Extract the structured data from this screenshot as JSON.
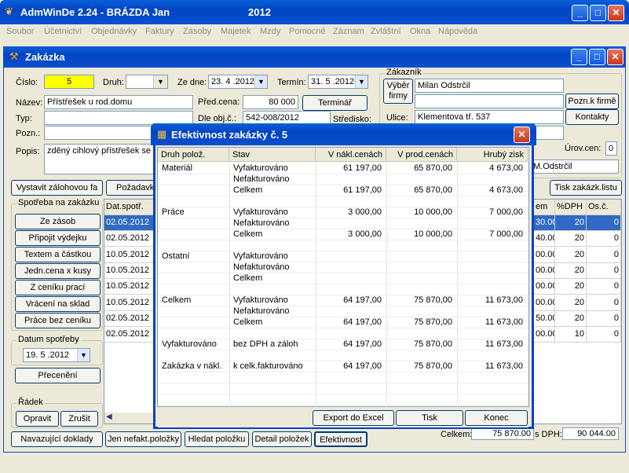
{
  "app": {
    "title": "AdmWinDe 2.24 - BRÁZDA Jan",
    "year": "2012"
  },
  "menu": [
    "Soubor",
    "Účetnictví",
    "Objednávky",
    "Faktury",
    "Zásoby",
    "Majetek",
    "Mzdy",
    "Pomocné",
    "Záznam",
    "Zvláštní",
    "Okna",
    "Nápověda"
  ],
  "child": {
    "title": "Zakázka"
  },
  "form": {
    "cislo_label": "Číslo:",
    "cislo": "5",
    "druh_label": "Druh:",
    "zedne_label": "Ze dne:",
    "zedne": "23. 4 .2012",
    "termin_label": "Termín:",
    "termin": "31. 5 .2012",
    "nazev_label": "Název:",
    "nazev": "Přístřešek u rod.domu",
    "predcena_label": "Před.cena:",
    "predcena": "80 000",
    "terminar_btn": "Terminář",
    "typ_label": "Typ:",
    "dleobj_label": "Dle obj.č.:",
    "dleobj": "542-008/2012",
    "stredisko_label": "Středisko:",
    "pozn_label": "Pozn.:",
    "popis_label": "Popis:",
    "popis": "zděný cihlový přístřešek se s"
  },
  "zakaznik": {
    "group_label": "Zákazník",
    "vyber_btn": "Výběr firmy",
    "name": "Milan Odstrčil",
    "pozn_firme_btn": "Pozn.k firmě",
    "kontakty_btn": "Kontakty",
    "ulice_label": "Ulice:",
    "ulice": "Klementova tř. 537",
    "urov_label": "Úrov.cen:",
    "urov": "0",
    "short_name": "M.Odstrčil"
  },
  "toolbar": {
    "zalohova": "Vystavit zálohovou fa",
    "pozadavek": "Požadavk",
    "tisk_listu": "Tisk zakázk.listu"
  },
  "spotreba": {
    "group_label": "Spotřeba na zakázku",
    "buttons": [
      "Ze zásob",
      "Připojit výdejku",
      "Textem a částkou",
      "Jedn.cena x kusy",
      "Z ceníku prací",
      "Vrácení na sklad",
      "Práce bez ceníku"
    ]
  },
  "datum": {
    "group_label": "Datum spotřeby",
    "value": "19. 5 .2012",
    "preceneni_btn": "Přecenění"
  },
  "radek": {
    "group_label": "Řádek",
    "opravit": "Opravit",
    "zrusit": "Zrušit"
  },
  "grid": {
    "head_left": "Dat.spotř.",
    "head_right": [
      "em",
      "%DPH",
      "Os.č."
    ],
    "dates": [
      "02.05.2012",
      "02.05.2012",
      "10.05.2012",
      "10.05.2012",
      "10.05.2012",
      "10.05.2012",
      "02.05.2012",
      "02.05.2012"
    ],
    "right_rows": [
      [
        "30.00",
        "20",
        "0"
      ],
      [
        "40.00",
        "20",
        "0"
      ],
      [
        "00.00",
        "20",
        "0"
      ],
      [
        "00.00",
        "20",
        "0"
      ],
      [
        "00.00",
        "20",
        "0"
      ],
      [
        "00.00",
        "20",
        "0"
      ],
      [
        "50.00",
        "20",
        "0"
      ],
      [
        "00.00",
        "10",
        "0"
      ]
    ]
  },
  "bottom": {
    "navazujici": "Navazující doklady",
    "jen_nefakt": "Jen nefakt.položky",
    "hledat": "Hledat položku",
    "detail": "Detail položek",
    "efektivnost": "Efektivnost",
    "celkem_label": "Celkem:",
    "celkem": "75 870.00",
    "sdph_label": "s DPH:",
    "sdph": "90 044.00"
  },
  "dialog": {
    "title": "Efektivnost zakázky č. 5",
    "headers": [
      "Druh polož.",
      "Stav",
      "V nákl.cenách",
      "V prod.cenách",
      "Hrubý zisk"
    ],
    "rows": [
      [
        "Materiál",
        "Vyfakturováno",
        "61 197,00",
        "65 870,00",
        "4 673,00"
      ],
      [
        "",
        "Nefakturováno",
        "",
        "",
        ""
      ],
      [
        "",
        "Celkem",
        "61 197,00",
        "65 870,00",
        "4 673,00"
      ],
      [
        "",
        "",
        "",
        "",
        ""
      ],
      [
        "Práce",
        "Vyfakturováno",
        "3 000,00",
        "10 000,00",
        "7 000,00"
      ],
      [
        "",
        "Nefakturováno",
        "",
        "",
        ""
      ],
      [
        "",
        "Celkem",
        "3 000,00",
        "10 000,00",
        "7 000,00"
      ],
      [
        "",
        "",
        "",
        "",
        ""
      ],
      [
        "Ostatní",
        "Vyfakturováno",
        "",
        "",
        ""
      ],
      [
        "",
        "Nefakturováno",
        "",
        "",
        ""
      ],
      [
        "",
        "Celkem",
        "",
        "",
        ""
      ],
      [
        "",
        "",
        "",
        "",
        ""
      ],
      [
        "Celkem",
        "Vyfakturováno",
        "64 197,00",
        "75 870,00",
        "11 673,00"
      ],
      [
        "",
        "Nefakturováno",
        "",
        "",
        ""
      ],
      [
        "",
        "Celkem",
        "64 197,00",
        "75 870,00",
        "11 673,00"
      ],
      [
        "",
        "",
        "",
        "",
        ""
      ],
      [
        "Vyfakturováno",
        "bez DPH a záloh",
        "64 197,00",
        "75 870,00",
        "11 673,00"
      ],
      [
        "",
        "",
        "",
        "",
        ""
      ],
      [
        "Zakázka v nákl.",
        "k celk.fakturováno",
        "64 197,00",
        "75 870,00",
        "11 673,00"
      ]
    ],
    "export_btn": "Export do Excel",
    "tisk_btn": "Tisk",
    "konec_btn": "Konec"
  }
}
